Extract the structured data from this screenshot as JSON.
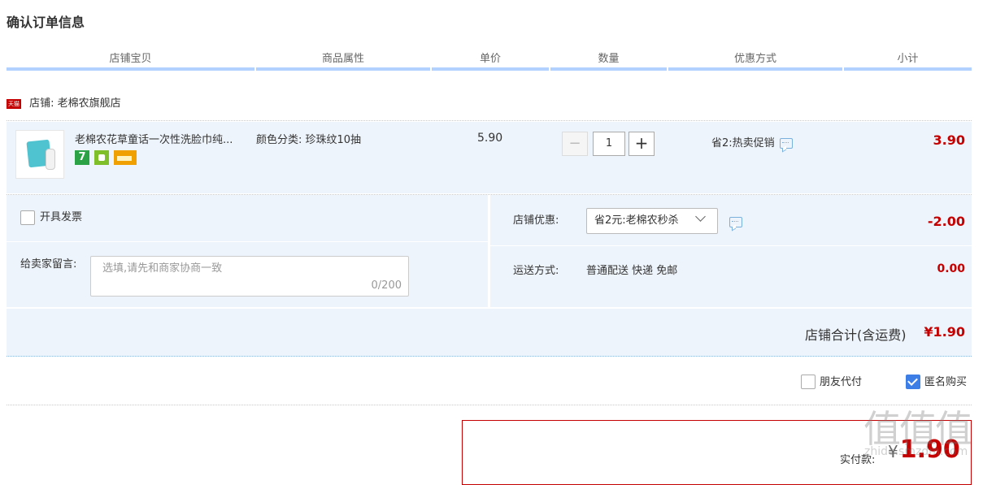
{
  "page_title": "确认订单信息",
  "columns": [
    "店铺宝贝",
    "商品属性",
    "单价",
    "数量",
    "优惠方式",
    "小计"
  ],
  "shop": {
    "badge_text": "天猫",
    "label": "店铺: 老棉农旗舰店"
  },
  "item": {
    "title": "老棉农花草童话一次性洗脸巾纯...",
    "attribute": "颜色分类: 珍珠纹10抽",
    "badges": [
      "7"
    ],
    "unit_price": "5.90",
    "quantity": "1",
    "quantity_minus": "−",
    "quantity_plus": "+",
    "promotion": "省2:热卖促销",
    "subtotal": "3.90"
  },
  "options": {
    "invoice_label": "开具发票",
    "message_label": "给卖家留言:",
    "message_placeholder": "选填,请先和商家协商一致",
    "message_count": "0/200",
    "shop_discount_label": "店铺优惠:",
    "shop_discount_selected": "省2元:老棉农秒杀",
    "shop_discount_amount": "-2.00",
    "shipping_label": "运送方式:",
    "shipping_value": "普通配送 快递 免邮",
    "shipping_amount": "0.00"
  },
  "shop_total": {
    "label": "店铺合计(含运费)",
    "amount": "¥1.90"
  },
  "checkout_options": {
    "friend_pay_label": "朋友代付",
    "friend_pay_checked": false,
    "anonymous_label": "匿名购买",
    "anonymous_checked": true
  },
  "payment": {
    "label": "实付款:",
    "currency": "¥",
    "amount": "1.90"
  },
  "watermark": {
    "text": "值值值",
    "sub": "zhide.smzdm.com"
  },
  "colors": {
    "accent_red": "#c40000",
    "row_bg": "#eef4fb",
    "header_line": "#b2d1ff",
    "checkbox_blue": "#3c7ee6"
  }
}
